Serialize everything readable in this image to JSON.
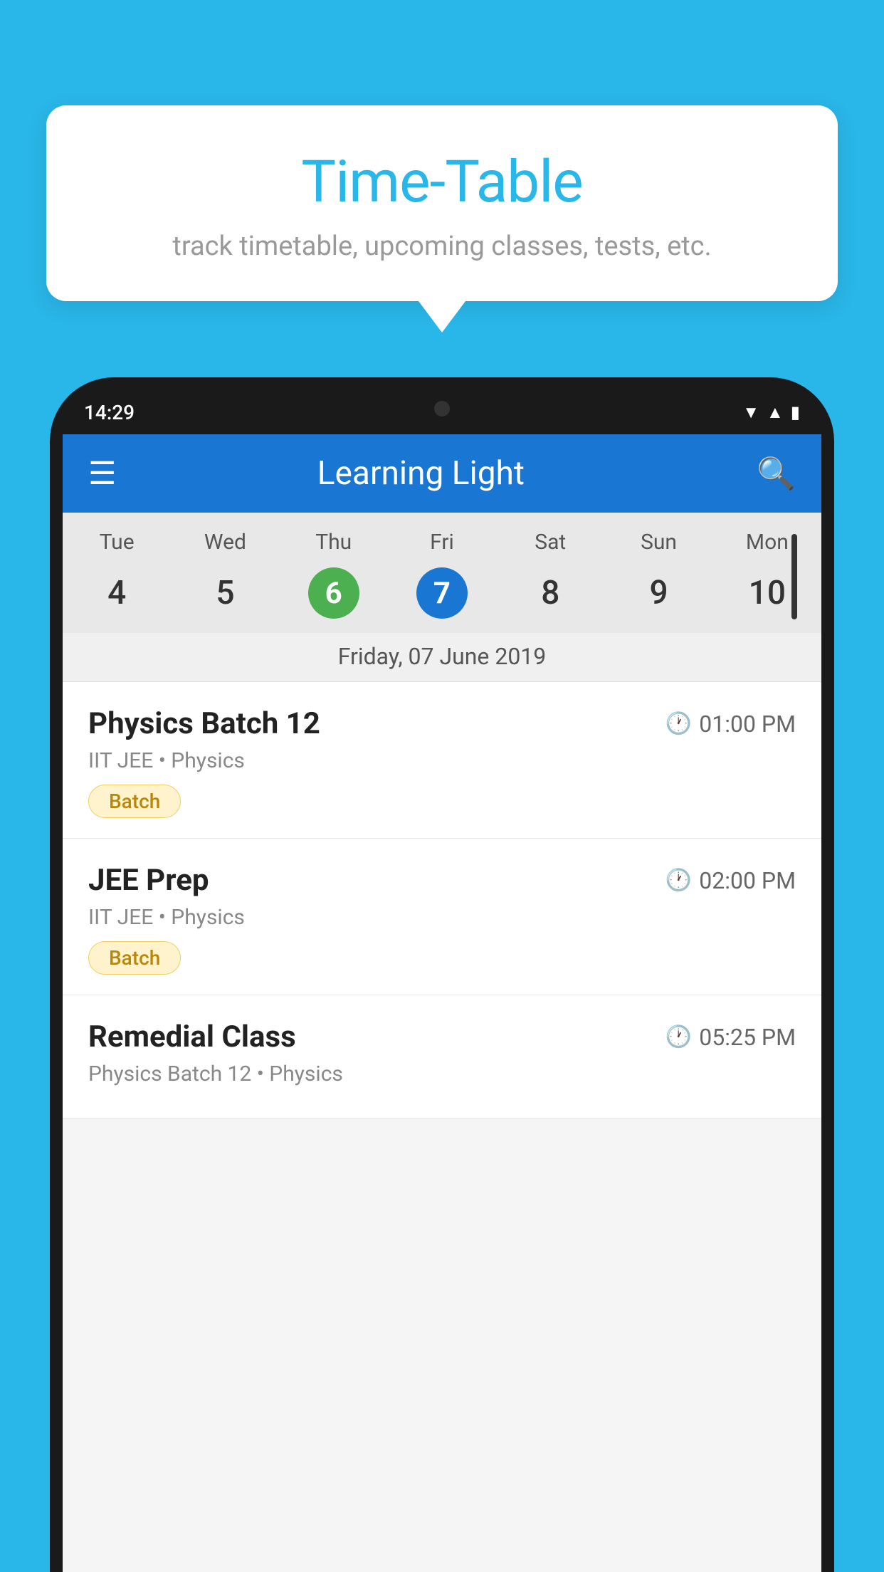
{
  "background_color": "#29B6E8",
  "bubble": {
    "title": "Time-Table",
    "subtitle": "track timetable, upcoming classes, tests, etc."
  },
  "phone": {
    "status_bar": {
      "time": "14:29"
    },
    "app_bar": {
      "title": "Learning Light"
    },
    "calendar": {
      "days": [
        {
          "abbr": "Tue",
          "num": "4"
        },
        {
          "abbr": "Wed",
          "num": "5"
        },
        {
          "abbr": "Thu",
          "num": "6",
          "style": "green"
        },
        {
          "abbr": "Fri",
          "num": "7",
          "style": "blue"
        },
        {
          "abbr": "Sat",
          "num": "8"
        },
        {
          "abbr": "Sun",
          "num": "9"
        },
        {
          "abbr": "Mon",
          "num": "10"
        }
      ],
      "selected_date": "Friday, 07 June 2019"
    },
    "schedule": [
      {
        "title": "Physics Batch 12",
        "time": "01:00 PM",
        "subtitle": "IIT JEE • Physics",
        "tag": "Batch"
      },
      {
        "title": "JEE Prep",
        "time": "02:00 PM",
        "subtitle": "IIT JEE • Physics",
        "tag": "Batch"
      },
      {
        "title": "Remedial Class",
        "time": "05:25 PM",
        "subtitle": "Physics Batch 12 • Physics",
        "tag": ""
      }
    ]
  }
}
